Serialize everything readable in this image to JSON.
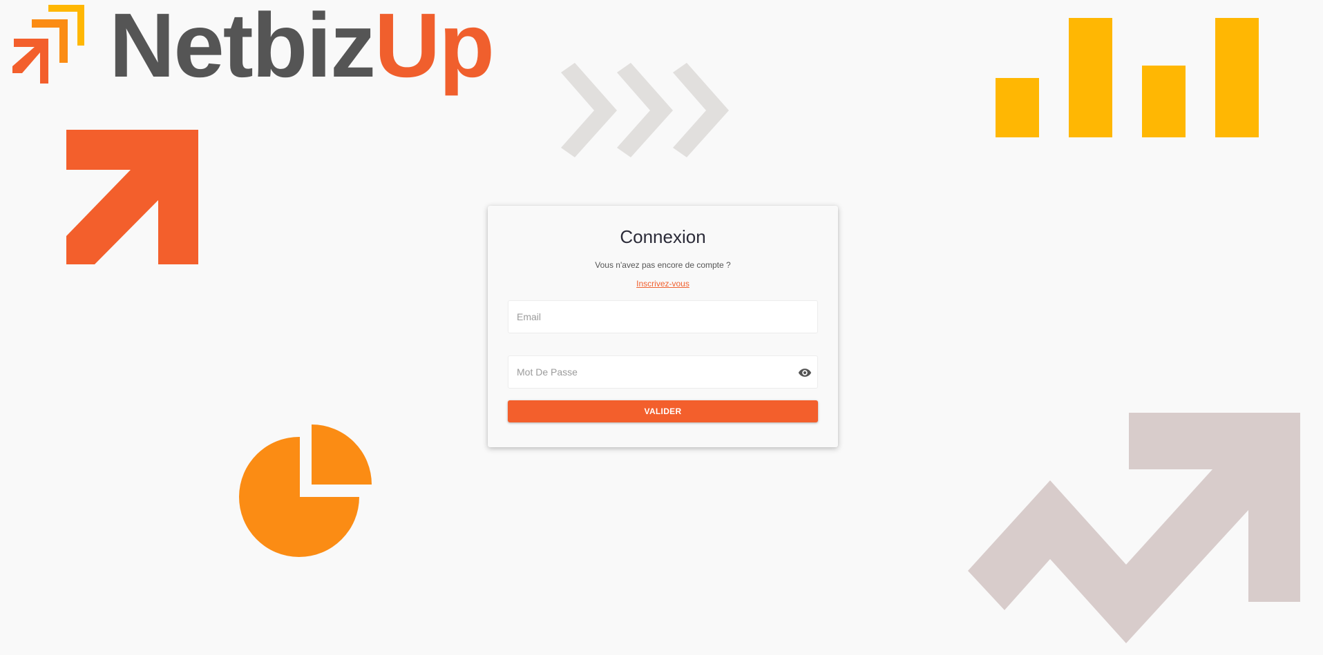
{
  "brand": {
    "name_part1": "Netbiz",
    "name_part2": "Up",
    "colors": {
      "dark_gray": "#555555",
      "orange_red": "#f05f2d",
      "orange": "#fb8c14",
      "yellow": "#ffb703",
      "light_gray": "#e1dfdd",
      "mauve_gray": "#d8cccb"
    }
  },
  "decorations": [
    "arrow-up-right-icon",
    "chevrons-right-icon",
    "bar-chart-icon",
    "pie-chart-icon",
    "trend-up-icon"
  ],
  "login": {
    "title": "Connexion",
    "no_account_text": "Vous n'avez pas encore de compte ?",
    "signup_link": "Inscrivez-vous",
    "email": {
      "value": "",
      "placeholder": "Email"
    },
    "password": {
      "value": "",
      "placeholder": "Mot De Passe",
      "toggle_icon": "eye-icon"
    },
    "submit_label": "VALIDER"
  }
}
